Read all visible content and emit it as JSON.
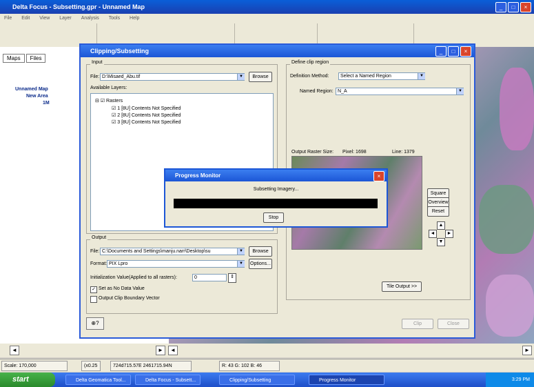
{
  "app": {
    "title": "Delta Focus - Subsetting.gpr - Unnamed Map",
    "menu": [
      "File",
      "Edit",
      "View",
      "Layer",
      "Analysis",
      "Tools",
      "Help"
    ]
  },
  "left_panel": {
    "tabs": [
      "Maps",
      "Files"
    ],
    "tree": [
      "Unnamed Map",
      "New Area",
      "1M"
    ]
  },
  "dialog": {
    "title": "Clipping/Subsetting",
    "input": {
      "label": "Input",
      "file_label": "File:",
      "file_value": "D:\\Misaed_Abu.tif",
      "browse": "Browse",
      "layers_label": "Available Layers:",
      "layers_root": "Rasters",
      "layers": [
        "1 [8U] Contents Not Specified",
        "2 [8U] Contents Not Specified",
        "3 [8U] Contents Not Specified"
      ]
    },
    "clip_region": {
      "label": "Define clip region",
      "method_label": "Definition Method:",
      "method_value": "Select a Named Region",
      "named_label": "Named Region:",
      "named_value": "N_A",
      "raster_size_label": "Output Raster Size:",
      "pixel": "Pixel: 1698",
      "line": "Line: 1379",
      "square": "Square",
      "overview": "Overview",
      "reset": "Reset",
      "tile_output": "Tile Output >>"
    },
    "output": {
      "label": "Output",
      "file_label": "File:",
      "file_value": "C:\\Documents and Settings\\manju.narr\\Desktop\\su",
      "browse": "Browse",
      "format_label": "Format:",
      "format_value": "PIX Lpro",
      "options": "Options...",
      "init_label": "Initialization Value(Applied to all rasters):",
      "init_value": "0",
      "nodata_label": "Set as No Data Value",
      "nodata_checked": true,
      "boundary_label": "Output Clip Boundary Vector",
      "boundary_checked": false
    },
    "clip_btn": "Clip",
    "close_btn": "Close"
  },
  "progress": {
    "title": "Progress Monitor",
    "message": "Subsetting Imagery...",
    "stop": "Stop",
    "fraction": 1.0
  },
  "status": {
    "scale": "Scale: 170,000",
    "zoom": "(x0.25",
    "coords": "724d715.57E 2461715.94N",
    "rgb": "R: 43 G: 102 B: 46"
  },
  "taskbar": {
    "start": "start",
    "tasks": [
      "Delta Geomatica Tool...",
      "Delta Focus - Subsett...",
      "Clipping/Subsetting",
      "Progress Monitor"
    ],
    "clock": "3:29 PM"
  }
}
